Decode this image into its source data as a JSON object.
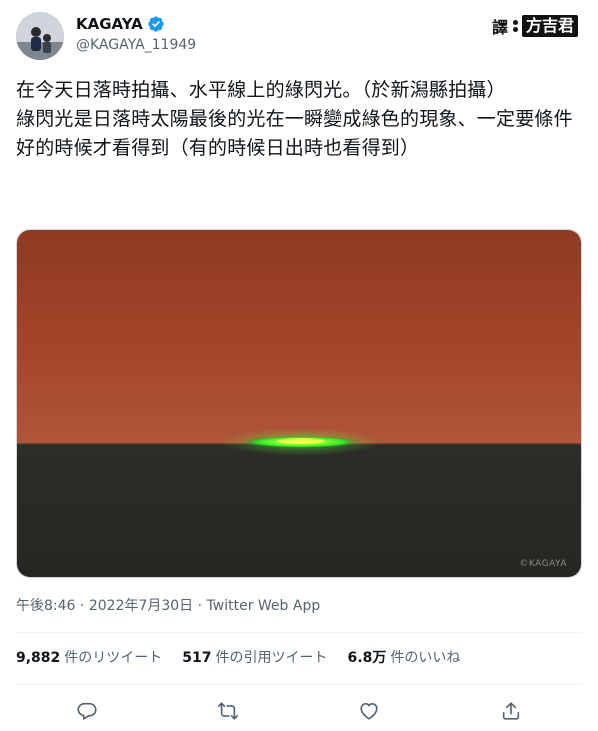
{
  "user": {
    "display_name": "KAGAYA",
    "handle": "@KAGAYA_11949",
    "verified": true
  },
  "translator_badge": {
    "label": "譯",
    "name": "方吉君"
  },
  "tweet": {
    "lines": [
      "在今天日落時拍攝、水平線上的綠閃光。（於新潟縣拍攝）",
      "綠閃光是日落時太陽最後的光在一瞬變成綠色的現象、一定要條件好的時候才看得到（有的時候日出時也看得到）"
    ]
  },
  "media": {
    "watermark": "©KAGAYA",
    "sky_color": "#a64426",
    "sea_color": "#2a2a26",
    "flash_color": "#3cff2c"
  },
  "meta": {
    "time": "午後8:46",
    "date": "2022年7月30日",
    "source": "Twitter Web App",
    "separator": " · "
  },
  "stats": [
    {
      "num": "9,882",
      "label": "件のリツイート"
    },
    {
      "num": "517",
      "label": "件の引用ツイート"
    },
    {
      "num": "6.8万",
      "label": "件のいいね"
    }
  ],
  "colors": {
    "verified_badge": "#1d9bf0",
    "secondary_text": "#536471",
    "icon": "#536471"
  },
  "icons": [
    "reply-icon",
    "retweet-icon",
    "like-icon",
    "share-icon"
  ]
}
